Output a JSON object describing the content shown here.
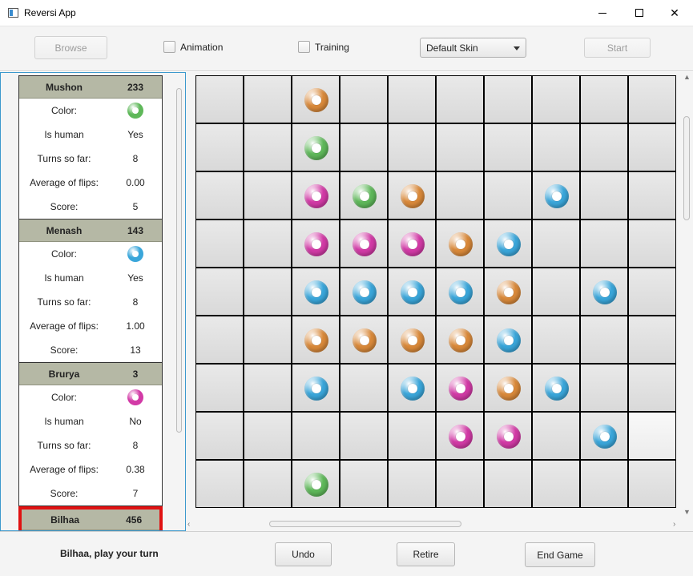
{
  "window": {
    "title": "Reversi App"
  },
  "toolbar": {
    "browse_label": "Browse",
    "animation_label": "Animation",
    "training_label": "Training",
    "skin_selected": "Default Skin",
    "start_label": "Start"
  },
  "colors": {
    "orange": "#d9893a",
    "green": "#5fb85a",
    "magenta": "#d23aa6",
    "blue": "#3aa6da",
    "active_border": "#e01212",
    "header_bg": "#b5b8a5"
  },
  "players": [
    {
      "name": "Mushon",
      "score_total": "233",
      "color": "green",
      "color_label": "Color:",
      "is_human_label": "Is human",
      "is_human": "Yes",
      "turns_label": "Turns so far:",
      "turns": "8",
      "avg_label": "Average of flips:",
      "avg": "0.00",
      "score_label": "Score:",
      "score": "5",
      "active": false
    },
    {
      "name": "Menash",
      "score_total": "143",
      "color": "blue",
      "color_label": "Color:",
      "is_human_label": "Is human",
      "is_human": "Yes",
      "turns_label": "Turns so far:",
      "turns": "8",
      "avg_label": "Average of flips:",
      "avg": "1.00",
      "score_label": "Score:",
      "score": "13",
      "active": false
    },
    {
      "name": "Brurya",
      "score_total": "3",
      "color": "magenta",
      "color_label": "Color:",
      "is_human_label": "Is human",
      "is_human": "No",
      "turns_label": "Turns so far:",
      "turns": "8",
      "avg_label": "Average of flips:",
      "avg": "0.38",
      "score_label": "Score:",
      "score": "7",
      "active": false
    },
    {
      "name": "Bilhaa",
      "score_total": "456",
      "active": true
    }
  ],
  "board": {
    "visible_rows": 9,
    "visible_cols": 10,
    "pieces": [
      {
        "row": 0,
        "col": 2,
        "color": "orange"
      },
      {
        "row": 1,
        "col": 2,
        "color": "green"
      },
      {
        "row": 2,
        "col": 2,
        "color": "magenta"
      },
      {
        "row": 2,
        "col": 3,
        "color": "green"
      },
      {
        "row": 2,
        "col": 4,
        "color": "orange"
      },
      {
        "row": 2,
        "col": 7,
        "color": "blue"
      },
      {
        "row": 3,
        "col": 2,
        "color": "magenta"
      },
      {
        "row": 3,
        "col": 3,
        "color": "magenta"
      },
      {
        "row": 3,
        "col": 4,
        "color": "magenta"
      },
      {
        "row": 3,
        "col": 5,
        "color": "orange"
      },
      {
        "row": 3,
        "col": 6,
        "color": "blue"
      },
      {
        "row": 4,
        "col": 2,
        "color": "blue"
      },
      {
        "row": 4,
        "col": 3,
        "color": "blue"
      },
      {
        "row": 4,
        "col": 4,
        "color": "blue"
      },
      {
        "row": 4,
        "col": 5,
        "color": "blue"
      },
      {
        "row": 4,
        "col": 6,
        "color": "orange"
      },
      {
        "row": 4,
        "col": 8,
        "color": "blue"
      },
      {
        "row": 5,
        "col": 2,
        "color": "orange"
      },
      {
        "row": 5,
        "col": 3,
        "color": "orange"
      },
      {
        "row": 5,
        "col": 4,
        "color": "orange"
      },
      {
        "row": 5,
        "col": 5,
        "color": "orange"
      },
      {
        "row": 5,
        "col": 6,
        "color": "blue"
      },
      {
        "row": 6,
        "col": 2,
        "color": "blue"
      },
      {
        "row": 6,
        "col": 4,
        "color": "blue"
      },
      {
        "row": 6,
        "col": 5,
        "color": "magenta"
      },
      {
        "row": 6,
        "col": 6,
        "color": "orange"
      },
      {
        "row": 6,
        "col": 7,
        "color": "blue"
      },
      {
        "row": 7,
        "col": 5,
        "color": "magenta"
      },
      {
        "row": 7,
        "col": 6,
        "color": "magenta"
      },
      {
        "row": 7,
        "col": 8,
        "color": "blue"
      },
      {
        "row": 8,
        "col": 2,
        "color": "green"
      }
    ]
  },
  "status": {
    "message": "Bilhaa, play your turn",
    "undo_label": "Undo",
    "retire_label": "Retire",
    "end_game_label": "End Game"
  }
}
